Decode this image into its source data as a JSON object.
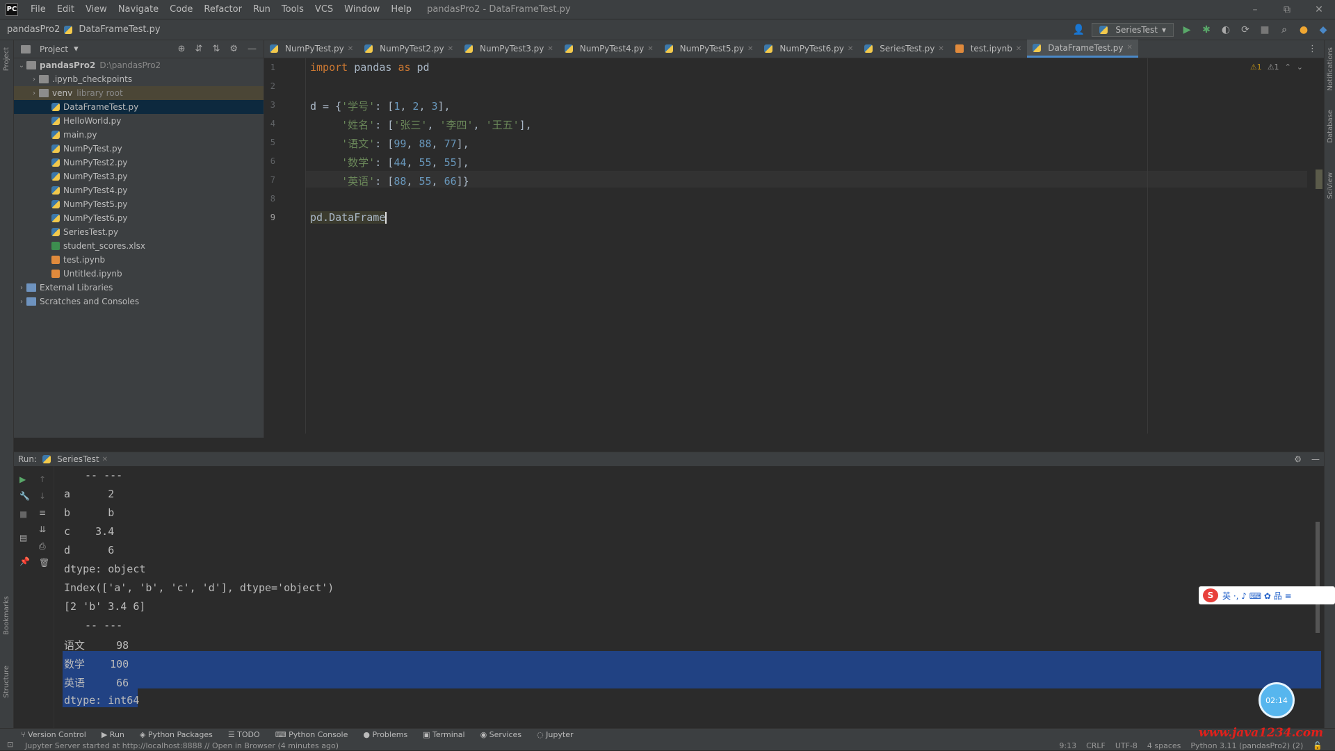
{
  "menubar": {
    "items": [
      "File",
      "Edit",
      "View",
      "Navigate",
      "Code",
      "Refactor",
      "Run",
      "Tools",
      "VCS",
      "Window",
      "Help"
    ],
    "title": "pandasPro2 - DataFrameTest.py"
  },
  "navbar": {
    "project": "pandasPro2",
    "file": "DataFrameTest.py",
    "run_config": "SeriesTest"
  },
  "project_panel": {
    "title": "Project",
    "tree": [
      {
        "label": "pandasPro2",
        "sub": "D:\\pandasPro2",
        "type": "folder",
        "depth": 0,
        "chev": "⌄"
      },
      {
        "label": ".ipynb_checkpoints",
        "sub": "",
        "type": "folder",
        "depth": 1,
        "chev": "›"
      },
      {
        "label": "venv",
        "sub": "library root",
        "type": "folder",
        "depth": 1,
        "chev": "›",
        "hl": true
      },
      {
        "label": "DataFrameTest.py",
        "sub": "",
        "type": "py",
        "depth": 2,
        "selected": true
      },
      {
        "label": "HelloWorld.py",
        "sub": "",
        "type": "py",
        "depth": 2
      },
      {
        "label": "main.py",
        "sub": "",
        "type": "py",
        "depth": 2
      },
      {
        "label": "NumPyTest.py",
        "sub": "",
        "type": "py",
        "depth": 2
      },
      {
        "label": "NumPyTest2.py",
        "sub": "",
        "type": "py",
        "depth": 2
      },
      {
        "label": "NumPyTest3.py",
        "sub": "",
        "type": "py",
        "depth": 2
      },
      {
        "label": "NumPyTest4.py",
        "sub": "",
        "type": "py",
        "depth": 2
      },
      {
        "label": "NumPyTest5.py",
        "sub": "",
        "type": "py",
        "depth": 2
      },
      {
        "label": "NumPyTest6.py",
        "sub": "",
        "type": "py",
        "depth": 2
      },
      {
        "label": "SeriesTest.py",
        "sub": "",
        "type": "py",
        "depth": 2
      },
      {
        "label": "student_scores.xlsx",
        "sub": "",
        "type": "xls",
        "depth": 2
      },
      {
        "label": "test.ipynb",
        "sub": "",
        "type": "ipynb",
        "depth": 2
      },
      {
        "label": "Untitled.ipynb",
        "sub": "",
        "type": "ipynb",
        "depth": 2
      },
      {
        "label": "External Libraries",
        "sub": "",
        "type": "libs",
        "depth": 0,
        "chev": "›"
      },
      {
        "label": "Scratches and Consoles",
        "sub": "",
        "type": "libs",
        "depth": 0,
        "chev": "›"
      }
    ]
  },
  "tabs": [
    "NumPyTest.py",
    "NumPyTest2.py",
    "NumPyTest3.py",
    "NumPyTest4.py",
    "NumPyTest5.py",
    "NumPyTest6.py",
    "SeriesTest.py",
    "test.ipynb",
    "DataFrameTest.py"
  ],
  "editor": {
    "inspections": {
      "warnings": "⚠1",
      "weak": "⚠1"
    },
    "line_numbers": [
      "1",
      "2",
      "3",
      "4",
      "5",
      "6",
      "7",
      "8",
      "9"
    ],
    "code": {
      "l1_kw1": "import",
      "l1_mod": " pandas ",
      "l1_kw2": "as",
      "l1_alias": " pd",
      "l3_pre": "d = {",
      "l3_key": "'学号'",
      "l3_mid": ": [",
      "l3_n1": "1",
      "l3_n2": "2",
      "l3_n3": "3",
      "l3_end": "],",
      "l4_key": "'姓名'",
      "l4_v1": "'张三'",
      "l4_v2": "'李四'",
      "l4_v3": "'王五'",
      "l5_key": "'语文'",
      "l5_n1": "99",
      "l5_n2": "88",
      "l5_n3": "77",
      "l6_key": "'数学'",
      "l6_n1": "44",
      "l6_n2": "55",
      "l6_n3": "55",
      "l7_key": "'英语'",
      "l7_n1": "88",
      "l7_n2": "55",
      "l7_n3": "66",
      "l7_end": "]}",
      "l9": "pd.DataFrame"
    }
  },
  "run_panel": {
    "label": "Run:",
    "tab": "SeriesTest",
    "output": [
      "-- ---",
      "a      2",
      "b      b",
      "c    3.4",
      "d      6",
      "dtype: object",
      "Index(['a', 'b', 'c', 'd'], dtype='object')",
      "[2 'b' 3.4 6]",
      "-- ---",
      "语文     98",
      "数学    100",
      "英语     66",
      "dtype: int64"
    ]
  },
  "status": {
    "tool_tabs": [
      "Version Control",
      "Run",
      "Python Packages",
      "TODO",
      "Python Console",
      "Problems",
      "Terminal",
      "Services",
      "Jupyter"
    ],
    "message": "Jupyter Server started at http://localhost:8888 // Open in Browser (4 minutes ago)",
    "position": "9:13",
    "line_sep": "CRLF",
    "encoding": "UTF-8",
    "indent": "4 spaces",
    "interpreter": "Python 3.11 (pandasPro2) (2)"
  },
  "overlays": {
    "ime_text": "英 ·, ♪ ⌨ ✿ 品 ≡",
    "timer": "02:14",
    "watermark": "www.java1234.com"
  },
  "colors": {
    "keyword": "#cc7832",
    "string": "#6a8759",
    "number": "#6897bb",
    "selection": "#214283",
    "tab_active": "#4a88c7"
  }
}
